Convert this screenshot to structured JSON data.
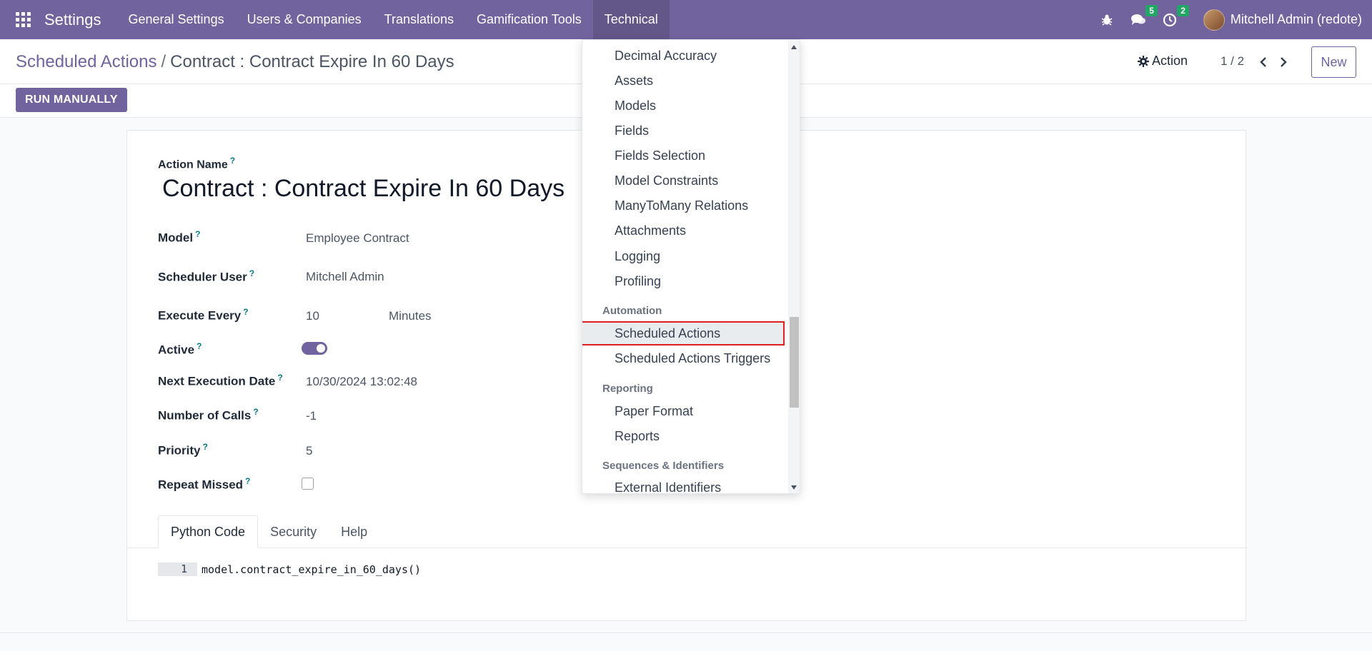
{
  "navbar": {
    "app_title": "Settings",
    "menu": [
      {
        "label": "General Settings"
      },
      {
        "label": "Users & Companies"
      },
      {
        "label": "Translations"
      },
      {
        "label": "Gamification Tools"
      },
      {
        "label": "Technical"
      }
    ],
    "messages_count": "5",
    "activities_count": "2",
    "user_name": "Mitchell Admin (redote)"
  },
  "breadcrumb": {
    "parent": "Scheduled Actions",
    "separator": "/",
    "current": "Contract : Contract Expire In 60 Days"
  },
  "control_panel": {
    "run_button": "RUN MANUALLY",
    "action_label": "Action",
    "pager": "1 / 2",
    "new_button": "New"
  },
  "form": {
    "action_name_label": "Action Name",
    "help_mark": "?",
    "title": "Contract : Contract Expire In 60 Days",
    "fields": {
      "model": {
        "label": "Model",
        "value": "Employee Contract"
      },
      "scheduler_user": {
        "label": "Scheduler User",
        "value": "Mitchell Admin"
      },
      "execute_every": {
        "label": "Execute Every",
        "value": "10",
        "unit": "Minutes"
      },
      "active": {
        "label": "Active"
      },
      "next_execution": {
        "label": "Next Execution Date",
        "value": "10/30/2024 13:02:48"
      },
      "number_of_calls": {
        "label": "Number of Calls",
        "value": "-1"
      },
      "priority": {
        "label": "Priority",
        "value": "5"
      },
      "repeat_missed": {
        "label": "Repeat Missed"
      }
    },
    "tabs": [
      {
        "label": "Python Code"
      },
      {
        "label": "Security"
      },
      {
        "label": "Help"
      }
    ],
    "code": {
      "line_number": "1",
      "text": "model.contract_expire_in_60_days()"
    }
  },
  "dropdown": {
    "items": [
      {
        "label": "Decimal Accuracy"
      },
      {
        "label": "Assets"
      },
      {
        "label": "Models"
      },
      {
        "label": "Fields"
      },
      {
        "label": "Fields Selection"
      },
      {
        "label": "Model Constraints"
      },
      {
        "label": "ManyToMany Relations"
      },
      {
        "label": "Attachments"
      },
      {
        "label": "Logging"
      },
      {
        "label": "Profiling"
      }
    ],
    "automation_header": "Automation",
    "automation_items": [
      {
        "label": "Scheduled Actions"
      },
      {
        "label": "Scheduled Actions Triggers"
      }
    ],
    "reporting_header": "Reporting",
    "reporting_items": [
      {
        "label": "Paper Format"
      },
      {
        "label": "Reports"
      }
    ],
    "sequences_header": "Sequences & Identifiers",
    "sequences_items": [
      {
        "label": "External Identifiers"
      }
    ]
  },
  "colors": {
    "brand": "#71639e",
    "badge": "#22a663",
    "highlight_border": "#e02020"
  }
}
